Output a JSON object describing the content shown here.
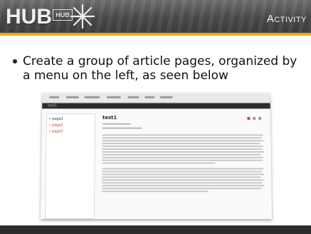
{
  "header": {
    "logo_text": "HUB",
    "logo_box_text": "HUB",
    "title": "Activity"
  },
  "bullets": [
    {
      "text": "Create a group of article pages, organized by a menu on the left, as seen below"
    }
  ],
  "screenshot": {
    "sidebar_items": [
      "• page1",
      "• page2",
      "• page3"
    ],
    "breadcrumb": "test1",
    "article_title": "test1"
  },
  "colors": {
    "accent": "#f0a818",
    "header": "#4a4a4a",
    "link": "#cc3333"
  }
}
